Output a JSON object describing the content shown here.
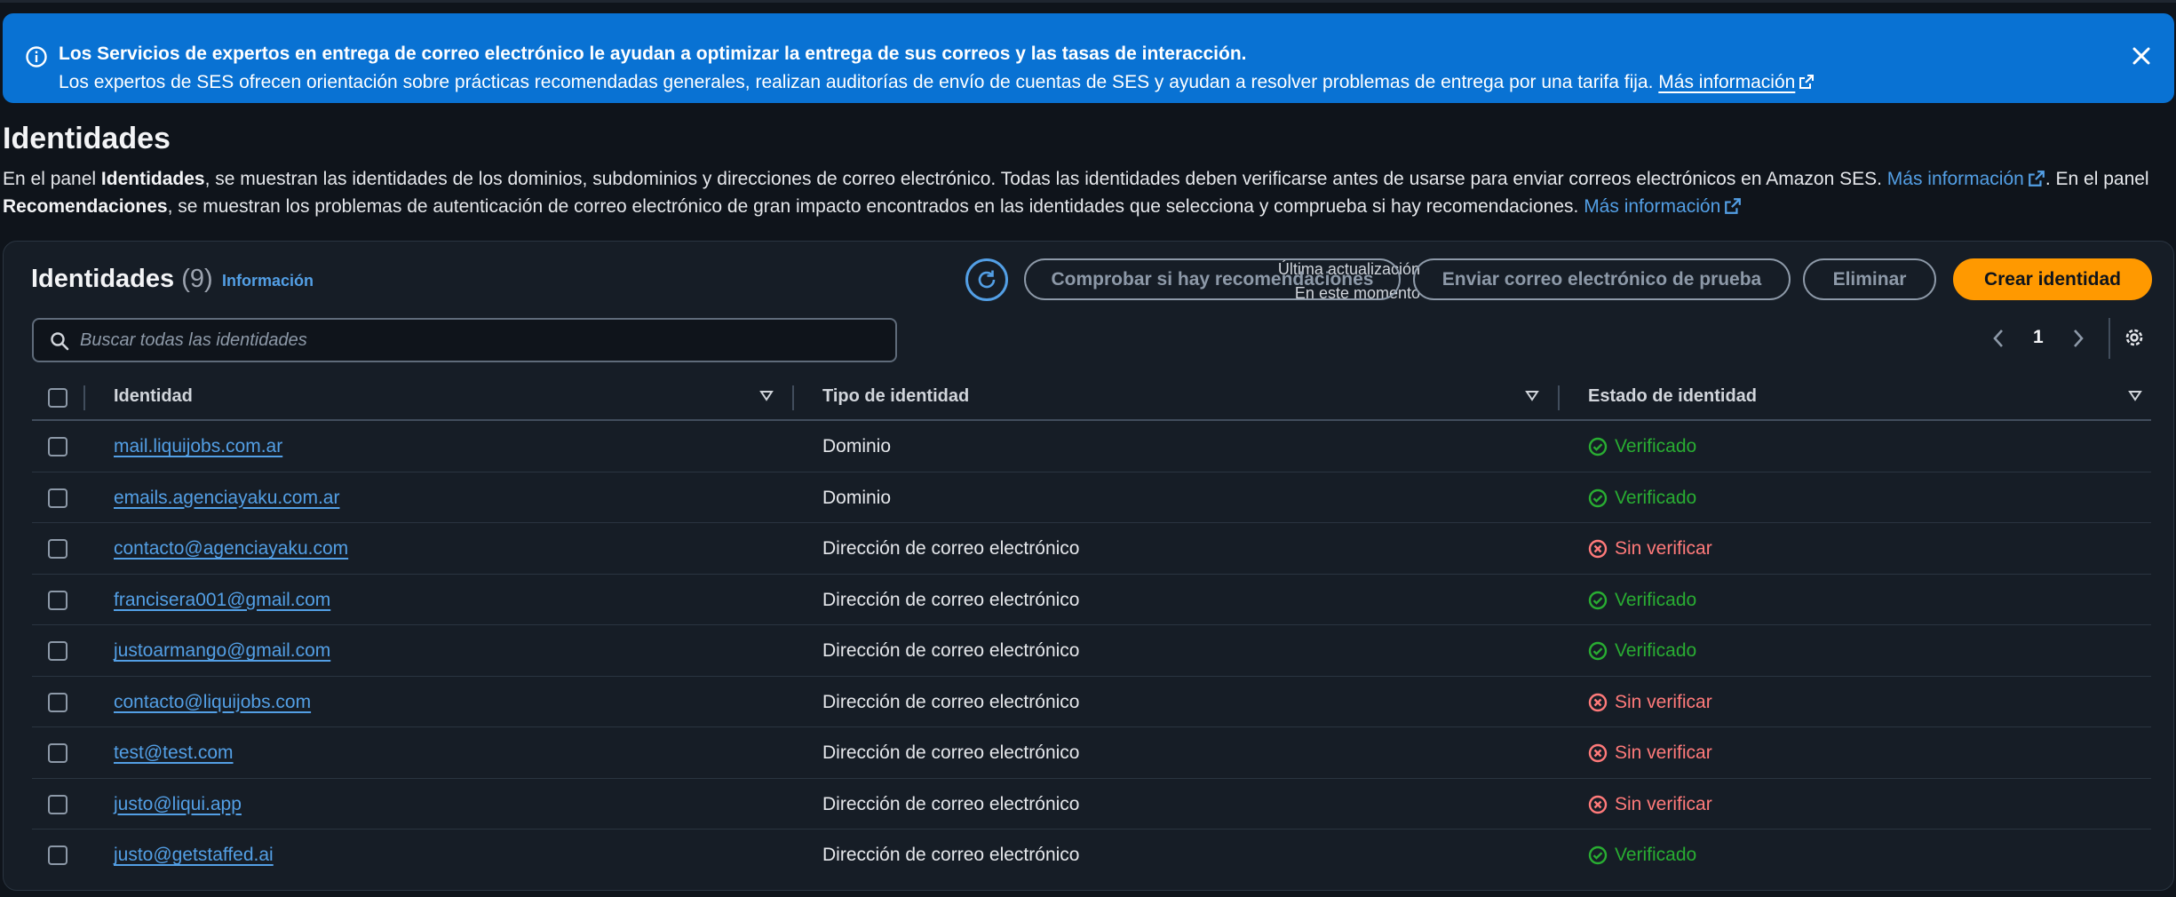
{
  "banner": {
    "title": "Los Servicios de expertos en entrega de correo electrónico le ayudan a optimizar la entrega de sus correos y las tasas de interacción.",
    "text": "Los expertos de SES ofrecen orientación sobre prácticas recomendadas generales, realizan auditorías de envío de cuentas de SES y ayudan a resolver problemas de entrega por una tarifa fija.",
    "link": "Más información"
  },
  "page": {
    "title": "Identidades",
    "desc_1": "En el panel ",
    "desc_bold_1": "Identidades",
    "desc_2": ", se muestran las identidades de los dominios, subdominios y direcciones de correo electrónico. Todas las identidades deben verificarse antes de usarse para enviar correos electrónicos en Amazon SES. ",
    "desc_link_1": "Más información",
    "desc_3": ". En el panel ",
    "desc_bold_2": "Recomendaciones",
    "desc_4": ", se muestran los problemas de autenticación de correo electrónico de gran impacto encontrados en las identidades que selecciona y comprueba si hay recomendaciones. ",
    "desc_link_2": "Más información"
  },
  "container": {
    "title": "Identidades",
    "count": "(9)",
    "info_link": "Información",
    "last_update_label": "Última actualización",
    "last_update_value": "En este momento",
    "buttons": {
      "recommendations": "Comprobar si hay recomendaciones",
      "send_test": "Enviar correo electrónico de prueba",
      "delete": "Eliminar",
      "create": "Crear identidad"
    },
    "search_placeholder": "Buscar todas las identidades",
    "page_number": "1"
  },
  "table": {
    "headers": {
      "identity": "Identidad",
      "type": "Tipo de identidad",
      "status": "Estado de identidad"
    },
    "rows": [
      {
        "identity": "mail.liquijobs.com.ar",
        "type": "Dominio",
        "status": "Verificado",
        "verified": true
      },
      {
        "identity": "emails.agenciayaku.com.ar",
        "type": "Dominio",
        "status": "Verificado",
        "verified": true
      },
      {
        "identity": "contacto@agenciayaku.com",
        "type": "Dirección de correo electrónico",
        "status": "Sin verificar",
        "verified": false
      },
      {
        "identity": "francisera001@gmail.com",
        "type": "Dirección de correo electrónico",
        "status": "Verificado",
        "verified": true
      },
      {
        "identity": "justoarmango@gmail.com",
        "type": "Dirección de correo electrónico",
        "status": "Verificado",
        "verified": true
      },
      {
        "identity": "contacto@liquijobs.com",
        "type": "Dirección de correo electrónico",
        "status": "Sin verificar",
        "verified": false
      },
      {
        "identity": "test@test.com",
        "type": "Dirección de correo electrónico",
        "status": "Sin verificar",
        "verified": false
      },
      {
        "identity": "justo@liqui.app",
        "type": "Dirección de correo electrónico",
        "status": "Sin verificar",
        "verified": false
      },
      {
        "identity": "justo@getstaffed.ai",
        "type": "Dirección de correo electrónico",
        "status": "Verificado",
        "verified": true
      }
    ]
  },
  "colors": {
    "banner_bg": "#0972d3",
    "link": "#539fe5",
    "primary_button": "#ff9900",
    "verified": "#29ad32",
    "unverified": "#ff7a7a"
  }
}
